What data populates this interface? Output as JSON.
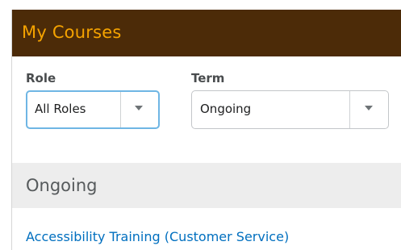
{
  "widget": {
    "title": "My Courses"
  },
  "filters": {
    "role": {
      "label": "Role",
      "selected": "All Roles"
    },
    "term": {
      "label": "Term",
      "selected": "Ongoing"
    }
  },
  "section": {
    "title": "Ongoing",
    "courses": [
      {
        "name": "Accessibility Training (Customer Service)"
      }
    ]
  },
  "colors": {
    "header_bg": "#4c2b08",
    "header_text": "#f5a300",
    "link": "#006fbf",
    "focus_border": "#6fb6e4",
    "section_bg": "#ededed"
  },
  "icons": [
    "chevron-down-icon"
  ]
}
